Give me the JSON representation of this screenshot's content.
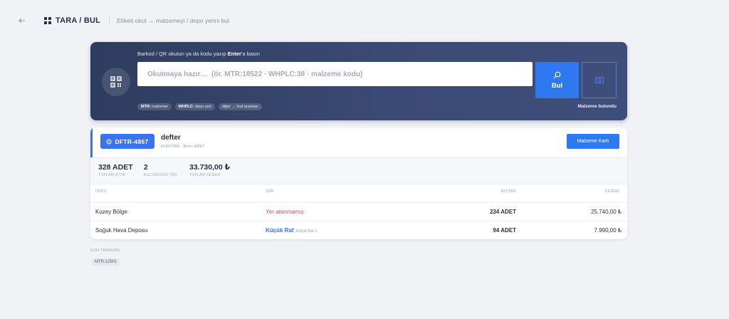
{
  "header": {
    "back_icon": "arrow-left-icon",
    "brand_icon": "grid-icon",
    "title": "TARA / BUL",
    "subtitle": "Etiketi okut → malzemeyi / depo yerini bul"
  },
  "scan": {
    "hint_prefix": "Barkod / QR okutun ya da kodu yazıp ",
    "hint_key": "Enter",
    "hint_suffix": "'a basın",
    "placeholder": "Okutmaya hazır…  (ör. MTR:18522 · WHPLC:38 · malzeme kodu)",
    "find_label": "Bul",
    "find_icon": "search-icon",
    "camera_icon": "camera-icon",
    "chips": [
      {
        "key": "MTR:",
        "text": " malzeme"
      },
      {
        "key": "WHPLC:",
        "text": " depo yeri"
      },
      {
        "key": "",
        "text": "diğer → kod araması"
      }
    ],
    "status": "Malzeme bulundu"
  },
  "result": {
    "code": "DFTR-4867",
    "code_icon": "tag-icon",
    "name": "defter",
    "meta": "ELEKTRİK  ·  Birim: ADET",
    "card_button": "Malzeme Kartı",
    "stats": [
      {
        "value": "328 ADET",
        "label": "TOPLAM STOK"
      },
      {
        "value": "2",
        "label": "BULUNDUĞU YER"
      },
      {
        "value": "33.730,00 ₺",
        "label": "TOPLAM DEĞER"
      }
    ],
    "columns": {
      "depo": "DEPO",
      "yer": "YER",
      "miktar": "MİKTAR",
      "deger": "DEĞER"
    },
    "rows": [
      {
        "depo": "Kuzey Bölge",
        "yer_warn": "Yer atanmamış",
        "miktar": "234 ADET",
        "deger": "25.740,00 ₺"
      },
      {
        "depo": "Soğuk Hava Deposu",
        "yer_main": "Küçük Raf",
        "yer_sub": "Küçük Raf 1",
        "miktar": "94 ADET",
        "deger": "7.990,00 ₺"
      }
    ]
  },
  "recent": {
    "title": "SON TARANAN",
    "items": [
      "MTR:12901"
    ]
  },
  "colors": {
    "accent": "#2f79f0",
    "panel": "#35436a",
    "warning": "#e04a5a"
  }
}
